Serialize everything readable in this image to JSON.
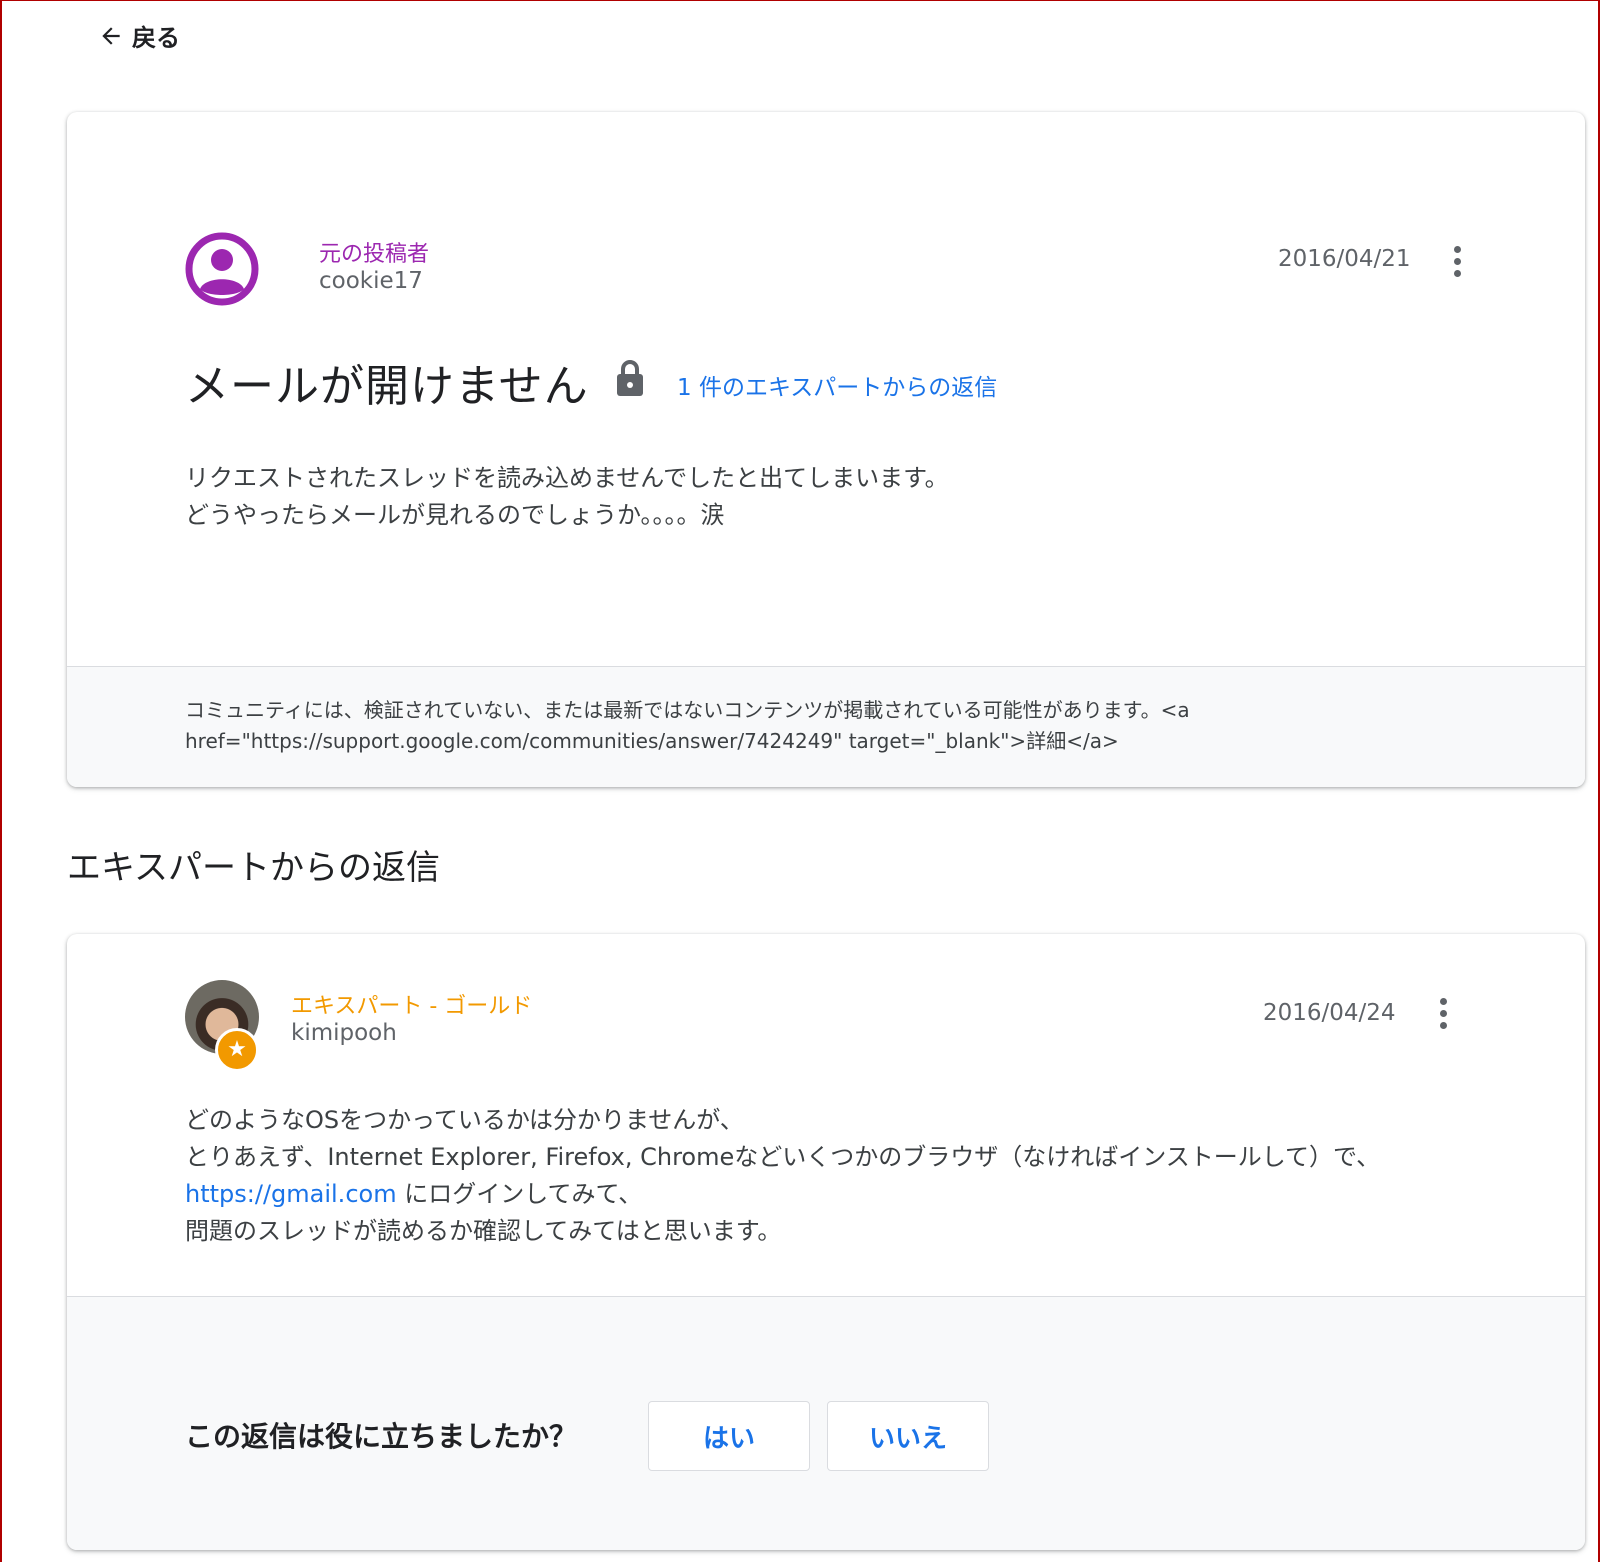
{
  "nav": {
    "back_label": "戻る"
  },
  "question": {
    "role": "元の投稿者",
    "role_color": "#9c27b0",
    "username": "cookie17",
    "date": "2016/04/21",
    "title": "メールが開けません",
    "reply_count_link": "1 件のエキスパートからの返信",
    "body_lines": [
      "リクエストされたスレッドを読み込めませんでしたと出てしまいます。",
      "どうやったらメールが見れるのでしょうか。。。。涙"
    ],
    "notice_lines": [
      "コミュニティには、検証されていない、または最新ではないコンテンツが掲載されている可能性があります。<a",
      "href=\"https://support.google.com/communities/answer/7424249\" target=\"_blank\">詳細</a>"
    ]
  },
  "expert_section_title": "エキスパートからの返信",
  "answer": {
    "role": "エキスパート - ゴールド",
    "role_color": "#f29900",
    "username": "kimipooh",
    "date": "2016/04/24",
    "line1": "どのようなOSをつかっているかは分かりませんが、",
    "line2": "とりあえず、Internet Explorer, Firefox, Chromeなどいくつかのブラウザ（なければインストールして）で、",
    "line3_link": "https://gmail.com",
    "line3_rest": " にログインしてみて、",
    "line4": "問題のスレッドが読めるか確認してみてはと思います。"
  },
  "feedback": {
    "question": "この返信は役に立ちましたか？",
    "yes_label": "はい",
    "no_label": "いいえ"
  },
  "icons": [
    "back-arrow-icon",
    "avatar-icon",
    "lock-icon",
    "more-vert-icon",
    "star-icon"
  ]
}
